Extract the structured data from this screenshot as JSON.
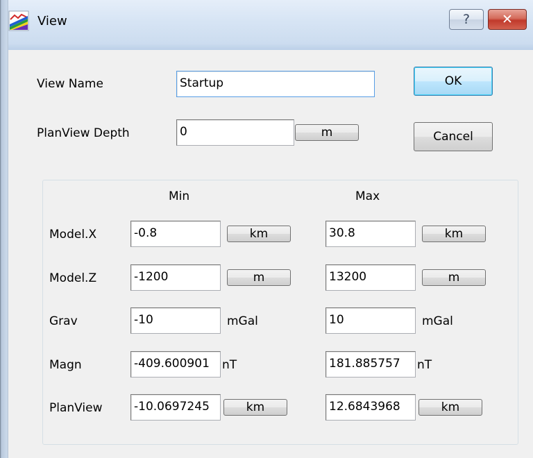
{
  "window": {
    "title": "View",
    "help_label": "?",
    "close_label": "✕"
  },
  "form": {
    "view_name_label": "View Name",
    "view_name_value": "Startup",
    "planview_depth_label": "PlanView Depth",
    "planview_depth_value": "0",
    "planview_depth_unit": "m",
    "ok_label": "OK",
    "cancel_label": "Cancel"
  },
  "ranges": {
    "min_header": "Min",
    "max_header": "Max",
    "rows": [
      {
        "label": "Model.X",
        "min": "-0.8",
        "max": "30.8",
        "unit": "km",
        "unit_is_button": true
      },
      {
        "label": "Model.Z",
        "min": "-1200",
        "max": "13200",
        "unit": "m",
        "unit_is_button": true
      },
      {
        "label": "Grav",
        "min": "-10",
        "max": "10",
        "unit": "mGal",
        "unit_is_button": false
      },
      {
        "label": "Magn",
        "min": "-409.600901",
        "max": "181.885757",
        "unit": "nT",
        "unit_is_button": false
      },
      {
        "label": "PlanView",
        "min": "-10.0697245",
        "max": "12.6843968",
        "unit": "km",
        "unit_is_button": true
      }
    ]
  },
  "colors": {
    "titlebar_top": "#e5eef9",
    "titlebar_bottom": "#c9daee",
    "close_button": "#c0392b",
    "default_button_border": "#3c7fb1"
  },
  "icons": {
    "app": "chart-rainbow-icon",
    "help": "help-icon",
    "close": "close-icon"
  }
}
